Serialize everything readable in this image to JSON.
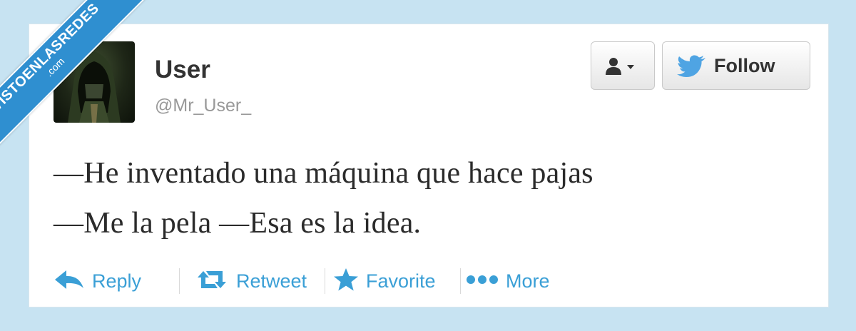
{
  "watermark": {
    "name": "VISTOENLASREDES",
    "domain": ".com"
  },
  "tweet": {
    "user": {
      "name": "User",
      "handle": "@Mr_User_"
    },
    "text": [
      "—He inventado una máquina que hace pajas",
      "—Me la pela —Esa es la idea."
    ]
  },
  "buttons": {
    "follow_label": "Follow"
  },
  "actions": {
    "reply": "Reply",
    "retweet": "Retweet",
    "favorite": "Favorite",
    "more": "More"
  },
  "colors": {
    "background": "#c7e3f2",
    "link": "#3a9fd6",
    "twitter_blue": "#4fa4e3",
    "banner": "#2f8fd0"
  },
  "icons": [
    "person-dropdown-icon",
    "twitter-bird-icon",
    "reply-icon",
    "retweet-icon",
    "star-icon",
    "more-dots-icon"
  ]
}
